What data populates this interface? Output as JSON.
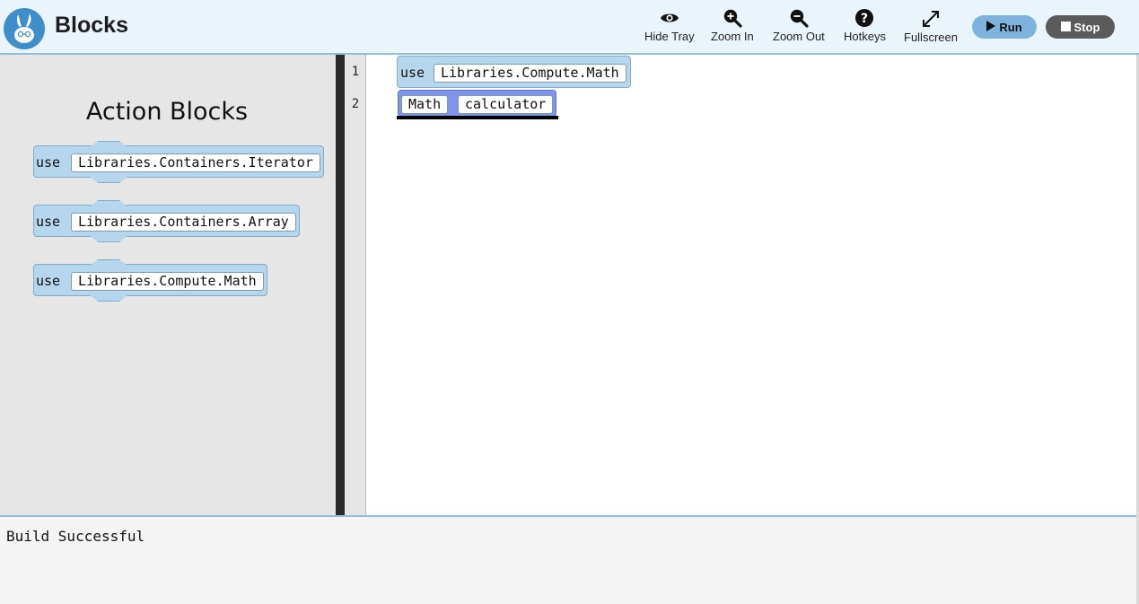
{
  "app": {
    "title": "Blocks"
  },
  "toolbar": {
    "hide_tray": "Hide Tray",
    "zoom_in": "Zoom In",
    "zoom_out": "Zoom Out",
    "hotkeys": "Hotkeys",
    "fullscreen": "Fullscreen",
    "run": "Run",
    "stop": "Stop"
  },
  "icons": {
    "logo": "bunny-logo-icon",
    "hide_tray": "eye-icon",
    "zoom_in": "zoom-in-icon",
    "zoom_out": "zoom-out-icon",
    "hotkeys": "question-icon",
    "fullscreen": "expand-icon",
    "run": "play-icon",
    "stop": "stop-icon"
  },
  "tray": {
    "title": "Action Blocks",
    "blocks": [
      {
        "keyword": "use",
        "value": "Libraries.Containers.Iterator"
      },
      {
        "keyword": "use",
        "value": "Libraries.Containers.Array"
      },
      {
        "keyword": "use",
        "value": "Libraries.Compute.Math"
      }
    ]
  },
  "editor": {
    "line_numbers": [
      "1",
      "2"
    ],
    "lines": [
      {
        "keyword": "use",
        "value": "Libraries.Compute.Math"
      },
      {
        "type": "Math",
        "name": "calculator",
        "selected": true
      }
    ]
  },
  "console": {
    "output": "Build Successful"
  },
  "colors": {
    "header_bg": "#eaf4fb",
    "accent": "#3d8ec9",
    "block": "#b5d6ec",
    "block_selected": "#7f95ec",
    "run_button": "#7eb3de",
    "stop_button": "#5b5b5b"
  }
}
